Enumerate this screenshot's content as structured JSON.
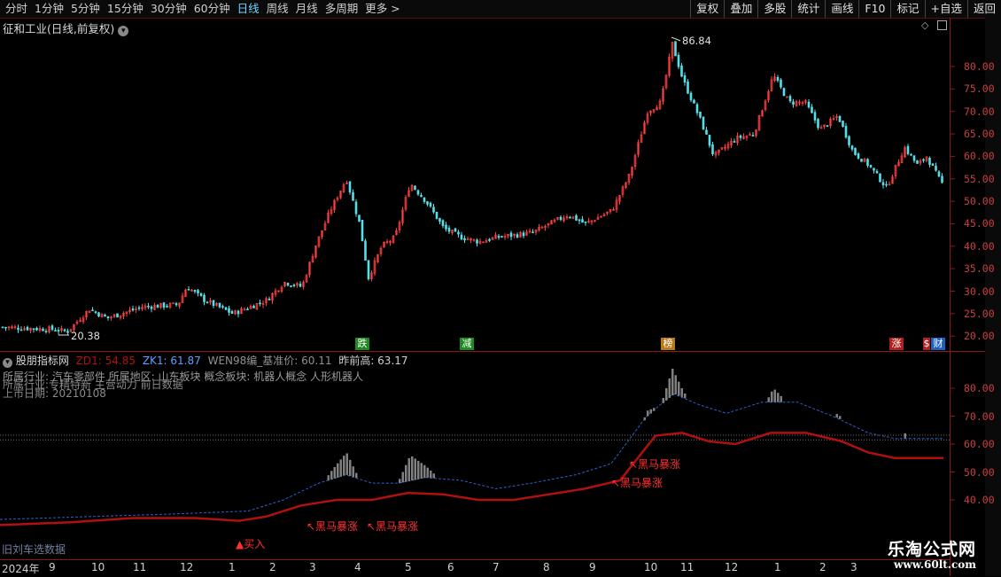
{
  "toolbar": {
    "periods": [
      "分时",
      "1分钟",
      "5分钟",
      "15分钟",
      "30分钟",
      "60分钟",
      "日线",
      "周线",
      "月线",
      "多周期",
      "更多 >"
    ],
    "actions": [
      "复权",
      "叠加",
      "多股",
      "统计",
      "画线",
      "F10",
      "标记",
      "+自选",
      "返回"
    ]
  },
  "stock": {
    "title": "征和工业(日线,前复权)"
  },
  "price_panel": {
    "high_label": "86.84",
    "low_label": "20.38",
    "y_ticks": [
      "80.00",
      "75.00",
      "70.00",
      "65.00",
      "60.00",
      "55.00",
      "50.00",
      "45.00",
      "40.00",
      "35.00",
      "30.00",
      "25.00",
      "20.00"
    ],
    "badges": [
      {
        "text": "跌",
        "color": "#1f8a1f"
      },
      {
        "text": "减",
        "color": "#1f8a1f"
      },
      {
        "text": "榜",
        "color": "#b87a1a"
      },
      {
        "text": "涨",
        "color": "#b02020"
      },
      {
        "text": "$",
        "color": "#b02020"
      },
      {
        "text": "财",
        "color": "#2060c0"
      }
    ]
  },
  "indicator_panel": {
    "name": "股朋指标网",
    "zd1": "ZD1: 54.85",
    "zk1": "ZK1: 61.87",
    "wen": "WEN98编_基准价: 60.11",
    "prev_high": "昨前高: 63.17",
    "info_line1": "所属行业:      汽车零部件   所属地区:      山东板块      概念板块:      机器人概念 人形机器人",
    "info_line2": "所属行业:专精特新 主营动力 前日数据",
    "info_line3": "上市日期: 20210108",
    "bottom_left_text": "旧刘车选数据",
    "y_ticks": [
      "80.00",
      "70.00",
      "60.00",
      "50.00",
      "40.00"
    ],
    "signals": [
      {
        "text": "▲买入",
        "color": "#ff3030"
      },
      {
        "text": "↖黑马暴涨",
        "color": "#ff3030"
      },
      {
        "text": "↖黑马暴涨",
        "color": "#ff3030"
      },
      {
        "text": "↖黑马暴涨",
        "color": "#ff3030"
      },
      {
        "text": "↖黑马暴涨",
        "color": "#ff3030"
      }
    ]
  },
  "date_axis": {
    "year_label": "2024年",
    "months": [
      "9",
      "10",
      "11",
      "12",
      "1",
      "2",
      "3",
      "4",
      "5",
      "6",
      "7",
      "8",
      "9",
      "10",
      "11",
      "12",
      "1",
      "2",
      "3"
    ]
  },
  "watermark": {
    "text": "乐淘公式网",
    "url": "www.60lt.com"
  },
  "colors": {
    "up": "#ff4040",
    "down": "#54e0e8",
    "axis": "#8a1a1a",
    "wen_line": "#2a60d0",
    "zd_line": "#b01010",
    "bars": "#808080"
  }
}
